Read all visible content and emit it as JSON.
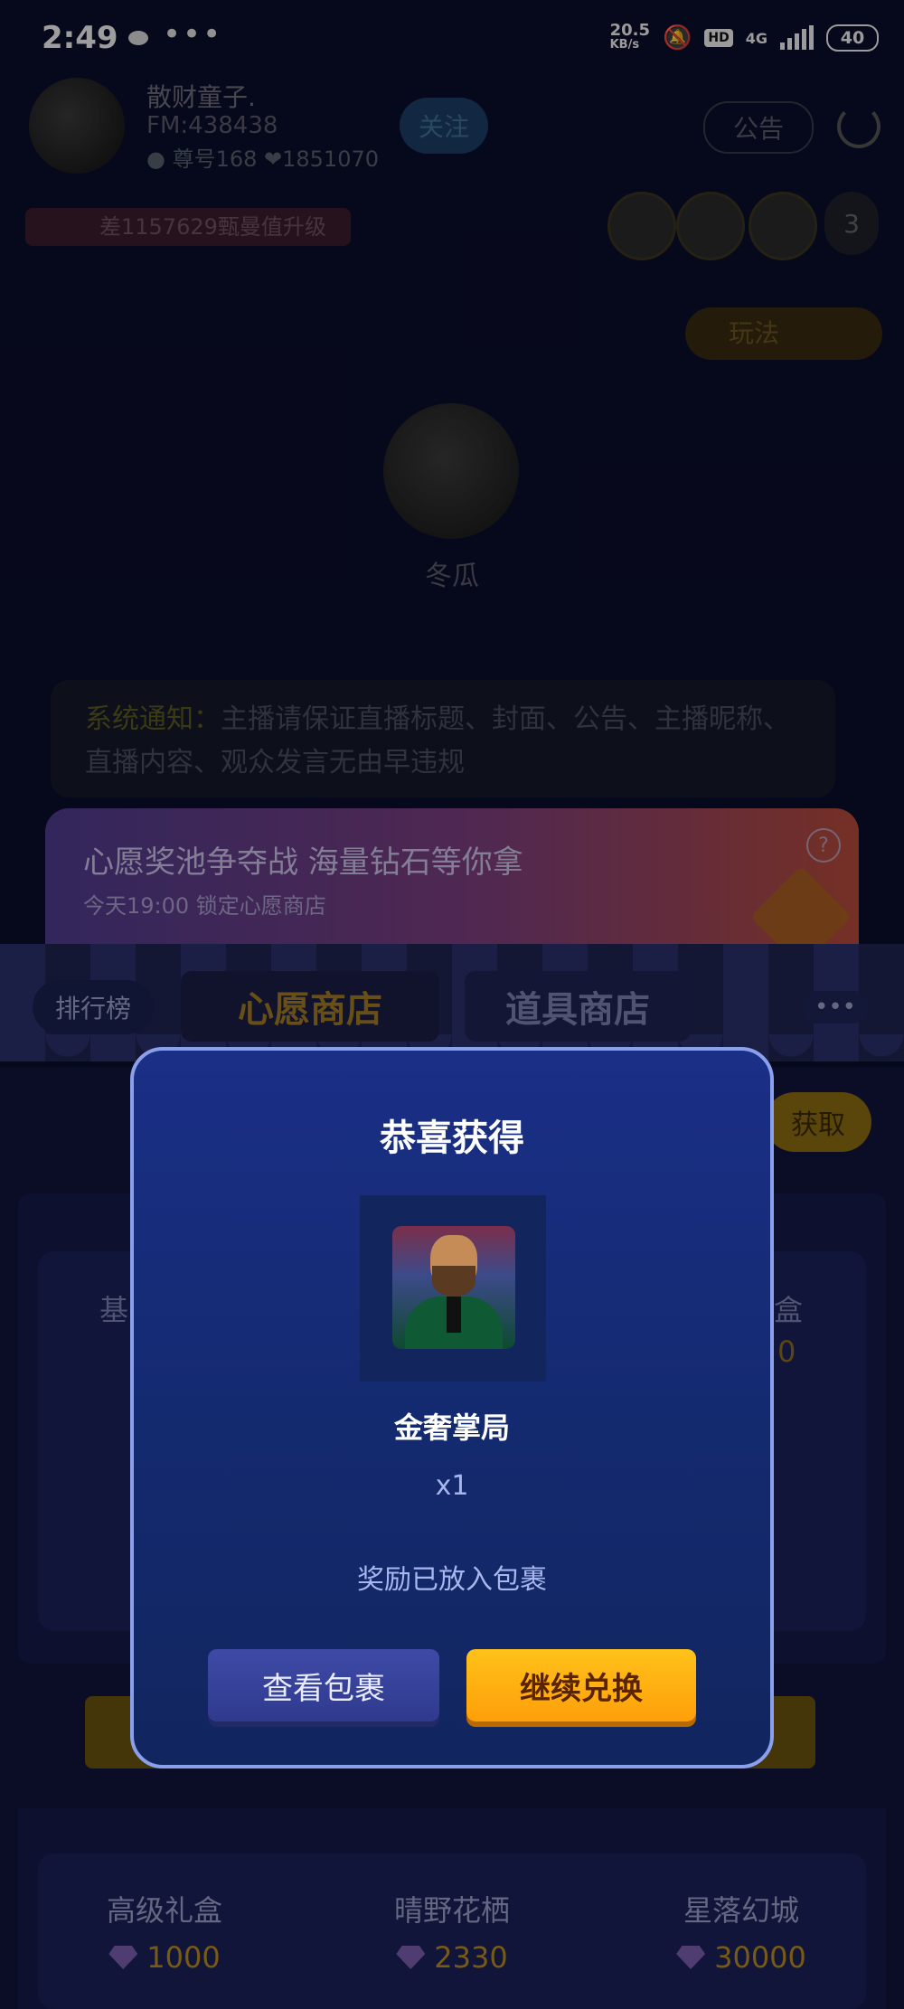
{
  "status_bar": {
    "time": "2:49",
    "more": "•••",
    "net_speed": "20.5",
    "net_unit": "KB/s",
    "hd": "HD",
    "network": "4G",
    "battery": "40"
  },
  "room": {
    "host_name": "散财童子.",
    "host_fm": "FM:438438",
    "host_stats": "● 尊号168   ❤1851070",
    "follow_label": "关注",
    "notice_label": "公告",
    "rank_text": "差1157629甄曼值升级",
    "viewer_count": "3",
    "gameplay_label": "玩法",
    "mic_user": "冬瓜",
    "system_notice_title": "系统通知：",
    "system_notice_text": "主播请保证直播标题、封面、公告、主播昵称、直播内容、观众发言无由早违规"
  },
  "shop": {
    "banner_title": "心愿奖池争夺战 海量钻石等你拿",
    "banner_sub": "今天19:00 锁定心愿商店",
    "banner_help": "?",
    "rank_tab": "排行榜",
    "tab_wish": "心愿商店",
    "tab_prop": "道具商店",
    "more": "•••",
    "get_label": "获取",
    "partial_left": "基",
    "partial_right": "盒",
    "partial_right_num": "0",
    "items": [
      {
        "name": "高级礼盒",
        "price": "1000"
      },
      {
        "name": "晴野花栖",
        "price": "2330"
      },
      {
        "name": "星落幻城",
        "price": "30000"
      }
    ]
  },
  "modal": {
    "title": "恭喜获得",
    "reward_name": "金奢掌局",
    "reward_qty": "x1",
    "note": "奖励已放入包裹",
    "view_button": "查看包裹",
    "continue_button": "继续兑换"
  },
  "colors": {
    "modal_bg": "#1a2f86",
    "modal_border": "#8aa0ea",
    "continue_btn": "#ffb014",
    "view_btn": "#3e4aa6"
  }
}
